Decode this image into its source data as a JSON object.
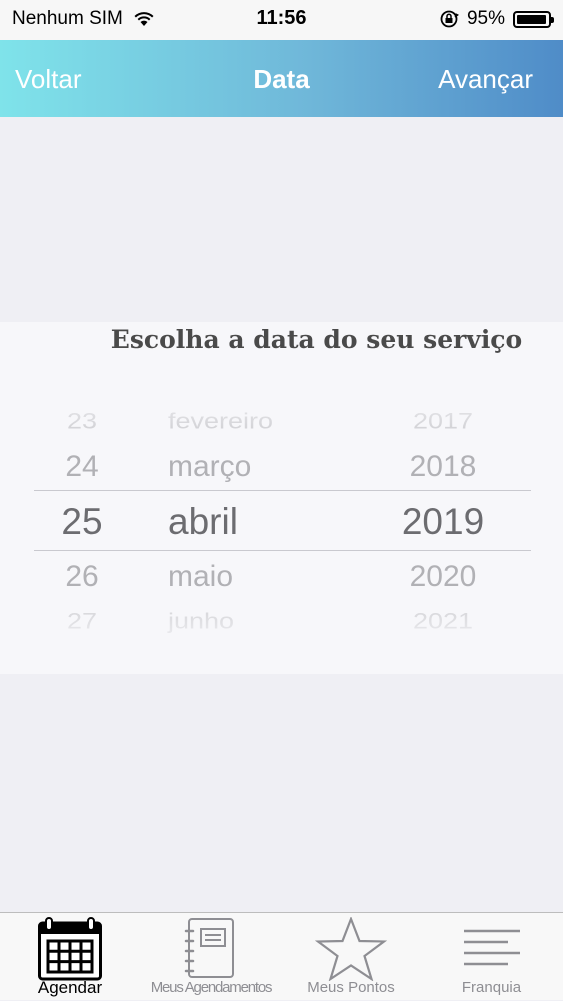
{
  "status_bar": {
    "carrier": "Nenhum SIM",
    "time": "11:56",
    "battery": "95%",
    "battery_level": 0.95,
    "icons": [
      "wifi-icon",
      "orientation-lock-icon",
      "battery-icon"
    ]
  },
  "nav": {
    "back_label": "Voltar",
    "title": "Data",
    "next_label": "Avançar",
    "gradient": [
      "#7fe3ea",
      "#4f8cc8"
    ]
  },
  "picker": {
    "title": "Escolha a data do seu serviço",
    "day": {
      "items": [
        "",
        "23",
        "24",
        "25",
        "26",
        "27",
        ""
      ],
      "selected": "25"
    },
    "month": {
      "items": [
        "",
        "fevereiro",
        "março",
        "abril",
        "maio",
        "junho",
        ""
      ],
      "selected": "abril"
    },
    "year": {
      "items": [
        "",
        "2017",
        "2018",
        "2019",
        "2020",
        "2021",
        ""
      ],
      "selected": "2019"
    }
  },
  "tabs": [
    {
      "label": "Agendar",
      "icon": "calendar-icon",
      "active": true
    },
    {
      "label": "Meus Agendamentos",
      "icon": "notebook-icon",
      "active": false
    },
    {
      "label": "Meus Pontos",
      "icon": "star-icon",
      "active": false
    },
    {
      "label": "Franquia",
      "icon": "menu-lines-icon",
      "active": false
    }
  ]
}
